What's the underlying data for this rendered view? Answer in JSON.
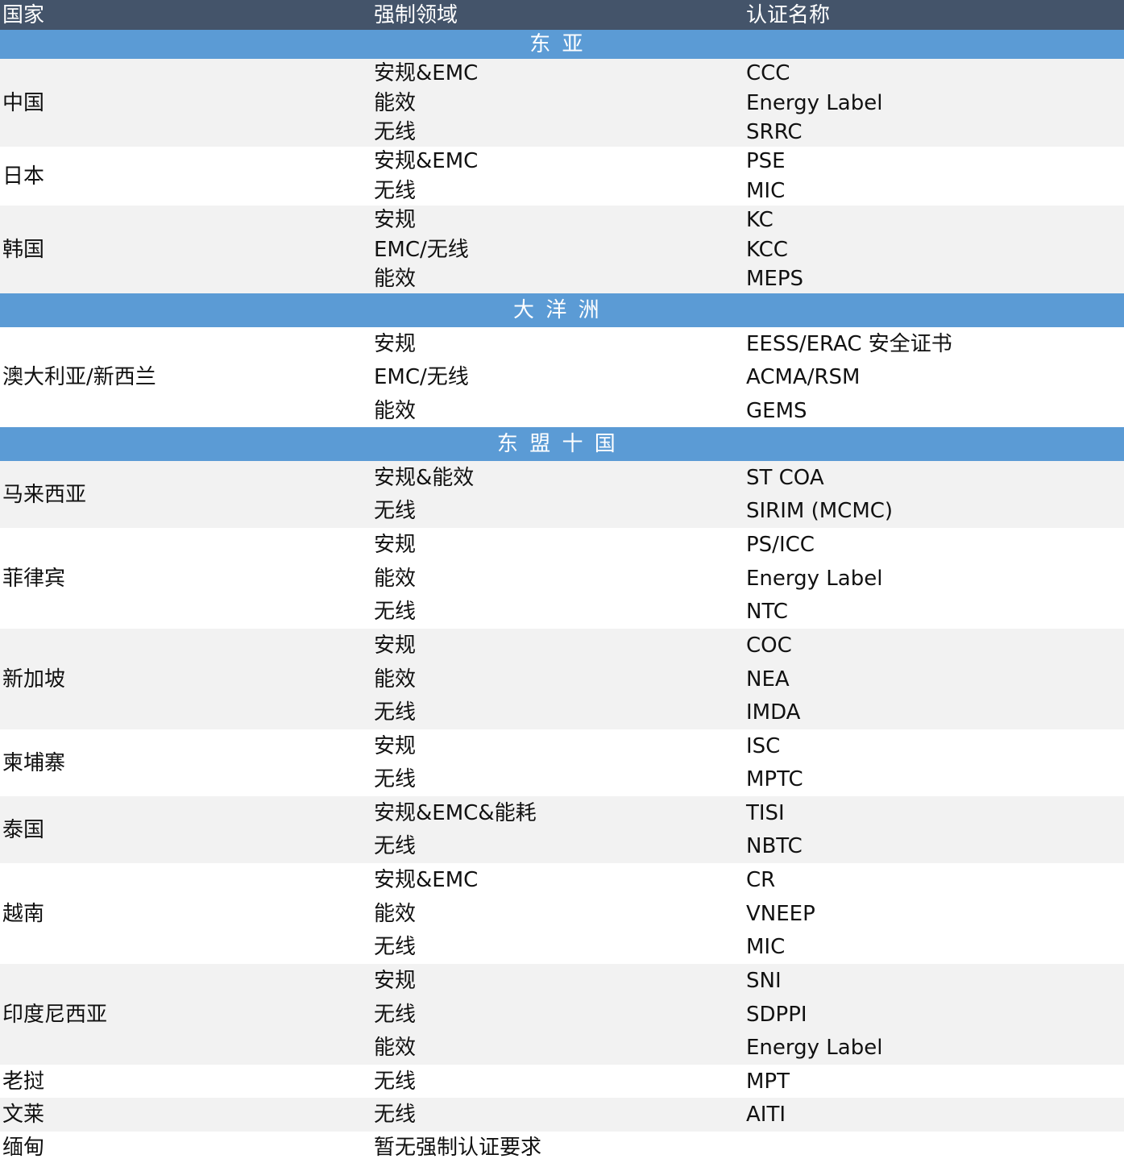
{
  "header": {
    "country": "国家",
    "domain": "强制领域",
    "cert": "认证名称"
  },
  "sections": [
    {
      "title": "东亚",
      "rows": [
        {
          "country": "中国",
          "items": [
            {
              "domain": "安规&EMC",
              "cert": "CCC"
            },
            {
              "domain": "能效",
              "cert": "Energy Label"
            },
            {
              "domain": "无线",
              "cert": "SRRC"
            }
          ]
        },
        {
          "country": "日本",
          "items": [
            {
              "domain": "安规&EMC",
              "cert": "PSE"
            },
            {
              "domain": "无线",
              "cert": "MIC"
            }
          ]
        },
        {
          "country": "韩国",
          "items": [
            {
              "domain": "安规",
              "cert": "KC"
            },
            {
              "domain": "EMC/无线",
              "cert": "KCC"
            },
            {
              "domain": "能效",
              "cert": "MEPS"
            }
          ]
        }
      ]
    },
    {
      "title": "大洋洲",
      "rows": [
        {
          "country": "澳大利亚/新西兰",
          "items": [
            {
              "domain": "安规",
              "cert": "EESS/ERAC 安全证书"
            },
            {
              "domain": "EMC/无线",
              "cert": "ACMA/RSM"
            },
            {
              "domain": "能效",
              "cert": "GEMS"
            }
          ]
        }
      ]
    },
    {
      "title": "东盟十国",
      "rows": [
        {
          "country": "马来西亚",
          "items": [
            {
              "domain": "安规&能效",
              "cert": "ST COA"
            },
            {
              "domain": "无线",
              "cert": "SIRIM (MCMC)"
            }
          ]
        },
        {
          "country": "菲律宾",
          "items": [
            {
              "domain": "安规",
              "cert": "PS/ICC"
            },
            {
              "domain": "能效",
              "cert": "Energy Label"
            },
            {
              "domain": "无线",
              "cert": "NTC"
            }
          ]
        },
        {
          "country": "新加坡",
          "items": [
            {
              "domain": "安规",
              "cert": "COC"
            },
            {
              "domain": "能效",
              "cert": "NEA"
            },
            {
              "domain": "无线",
              "cert": "IMDA"
            }
          ]
        },
        {
          "country": "柬埔寨",
          "items": [
            {
              "domain": "安规",
              "cert": "ISC"
            },
            {
              "domain": "无线",
              "cert": "MPTC"
            }
          ]
        },
        {
          "country": "泰国",
          "items": [
            {
              "domain": "安规&EMC&能耗",
              "cert": "TISI"
            },
            {
              "domain": "无线",
              "cert": "NBTC"
            }
          ]
        },
        {
          "country": "越南",
          "items": [
            {
              "domain": "安规&EMC",
              "cert": "CR"
            },
            {
              "domain": "能效",
              "cert": "VNEEP"
            },
            {
              "domain": "无线",
              "cert": "MIC"
            }
          ]
        },
        {
          "country": "印度尼西亚",
          "items": [
            {
              "domain": "安规",
              "cert": "SNI"
            },
            {
              "domain": "无线",
              "cert": "SDPPI"
            },
            {
              "domain": "能效",
              "cert": "Energy Label"
            }
          ]
        },
        {
          "country": "老挝",
          "items": [
            {
              "domain": "无线",
              "cert": "MPT"
            }
          ]
        },
        {
          "country": "文莱",
          "items": [
            {
              "domain": "无线",
              "cert": "AITI"
            }
          ]
        },
        {
          "country": "缅甸",
          "items": [
            {
              "domain": "暂无强制认证要求",
              "cert": ""
            }
          ]
        }
      ]
    }
  ]
}
